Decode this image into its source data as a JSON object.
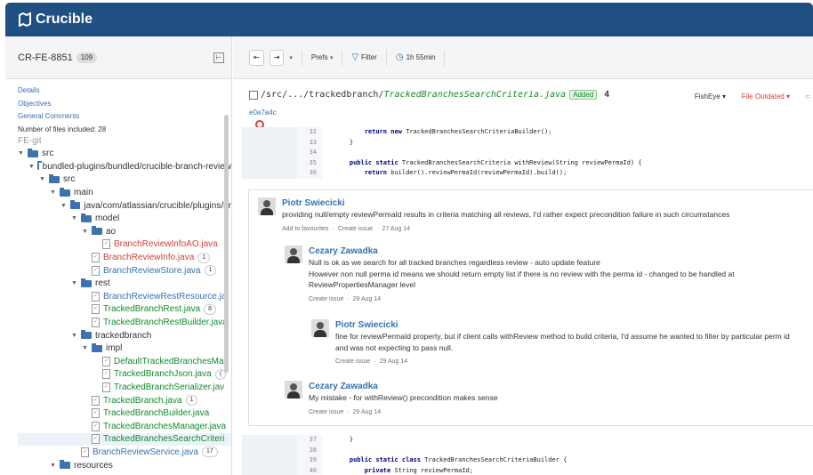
{
  "app": {
    "name": "Crucible"
  },
  "sidebar": {
    "review_key": "CR-FE-8851",
    "review_count": "109",
    "links": [
      "Details",
      "Objectives",
      "General Comments"
    ],
    "files_included": "Number of files included: 28",
    "group": "FE-git",
    "tree": [
      {
        "label": "src",
        "type": "folder",
        "depth": 0,
        "color": "dark"
      },
      {
        "label": "bundled-plugins/bundled/crucible-branch-review",
        "type": "folder",
        "depth": 1,
        "color": "dark"
      },
      {
        "label": "src",
        "type": "folder",
        "depth": 2,
        "color": "dark"
      },
      {
        "label": "main",
        "type": "folder",
        "depth": 3,
        "color": "dark"
      },
      {
        "label": "java/com/atlassian/crucible/plugins/br",
        "type": "folder",
        "depth": 4,
        "color": "dark"
      },
      {
        "label": "model",
        "type": "folder",
        "depth": 5,
        "color": "dark"
      },
      {
        "label": "ao",
        "type": "folder",
        "depth": 6,
        "color": "dark"
      },
      {
        "label": "BranchReviewInfoAO.java",
        "type": "file",
        "depth": 7,
        "color": "red",
        "badge": ""
      },
      {
        "label": "BranchReviewInfo.java",
        "type": "file",
        "depth": 6,
        "color": "red",
        "badge": "1"
      },
      {
        "label": "BranchReviewStore.java",
        "type": "file",
        "depth": 6,
        "color": "blue",
        "badge": "1"
      },
      {
        "label": "rest",
        "type": "folder",
        "depth": 5,
        "color": "dark"
      },
      {
        "label": "BranchReviewRestResource.ja",
        "type": "file",
        "depth": 6,
        "color": "blue",
        "badge": ""
      },
      {
        "label": "TrackedBranchRest.java",
        "type": "file",
        "depth": 6,
        "color": "green",
        "badge": "8"
      },
      {
        "label": "TrackedBranchRestBuilder.java",
        "type": "file",
        "depth": 6,
        "color": "green",
        "badge": ""
      },
      {
        "label": "trackedbranch",
        "type": "folder",
        "depth": 5,
        "color": "dark"
      },
      {
        "label": "impl",
        "type": "folder",
        "depth": 6,
        "color": "dark"
      },
      {
        "label": "DefaultTrackedBranchesMa",
        "type": "file",
        "depth": 7,
        "color": "green",
        "badge": ""
      },
      {
        "label": "TrackedBranchJson.java",
        "type": "file",
        "depth": 7,
        "color": "green",
        "badge": "("
      },
      {
        "label": "TrackedBranchSerializer.jav",
        "type": "file",
        "depth": 7,
        "color": "green",
        "badge": ""
      },
      {
        "label": "TrackedBranch.java",
        "type": "file",
        "depth": 6,
        "color": "green",
        "badge": "1"
      },
      {
        "label": "TrackedBranchBuilder.java",
        "type": "file",
        "depth": 6,
        "color": "green",
        "badge": ""
      },
      {
        "label": "TrackedBranchesManager.java",
        "type": "file",
        "depth": 6,
        "color": "green",
        "badge": ""
      },
      {
        "label": "TrackedBranchesSearchCriteri",
        "type": "file",
        "depth": 6,
        "color": "green",
        "badge": "",
        "selected": true
      },
      {
        "label": "BranchReviewService.java",
        "type": "file",
        "depth": 5,
        "color": "blue",
        "badge": "17"
      },
      {
        "label": "resources",
        "type": "folder",
        "depth": 3,
        "color": "dark"
      }
    ]
  },
  "toolbar": {
    "prefs": "Prefs",
    "filter": "Filter",
    "time": "1h 55min"
  },
  "file": {
    "path_prefix": "/src/.../trackedbranch/",
    "file_name": "TrackedBranchesSearchCriteria.java",
    "status": "Added",
    "count": "4",
    "commit": "e0a7a4c",
    "fisheye": "FishEye",
    "outdated": "File Outdated"
  },
  "code_top": [
    {
      "num": "32",
      "text": "        return new TrackedBranchesSearchCriteriaBuilder();"
    },
    {
      "num": "33",
      "text": "    }"
    },
    {
      "num": "34",
      "text": ""
    },
    {
      "num": "35",
      "text": "    public static TrackedBranchesSearchCriteria withReview(String reviewPermaId) {"
    },
    {
      "num": "36",
      "text": "        return builder().reviewPermaId(reviewPermaId).build();"
    }
  ],
  "code_bottom": [
    {
      "num": "37",
      "text": "    }"
    },
    {
      "num": "38",
      "text": ""
    },
    {
      "num": "39",
      "text": "    public static class TrackedBranchesSearchCriteriaBuilder {"
    },
    {
      "num": "40",
      "text": "        private String reviewPermaId;"
    }
  ],
  "comments": [
    {
      "author": "Piotr Swiecicki",
      "lines": [
        "providing null/empty reviewPermaId results in criteria matching all reviews, I'd rather expect precondition failure in such circumstances"
      ],
      "actions": [
        "Add to favourites",
        "Create issue"
      ],
      "date": "27 Aug 14"
    },
    {
      "author": "Cezary Zawadka",
      "lines": [
        "Null is ok as we search for all tracked branches regardless review - auto update feature",
        "However non null perma id means we should return empty list if there is no review with the perma id - changed to be handled at",
        "ReviewPropertiesManager level"
      ],
      "actions": [
        "Create issue"
      ],
      "date": "29 Aug 14"
    },
    {
      "author": "Piotr Swiecicki",
      "lines": [
        "fine for reviewPermaId property, but if client calls withReview method to build criteria, I'd assume he wanted to filter by particular perm id",
        "and was not expecting to pass null."
      ],
      "actions": [
        "Create issue"
      ],
      "date": "29 Aug 14"
    },
    {
      "author": "Cezary Zawadka",
      "lines": [
        "My mistake - for withReview() precondition makes sense"
      ],
      "actions": [
        "Create issue"
      ],
      "date": "29 Aug 14"
    }
  ]
}
